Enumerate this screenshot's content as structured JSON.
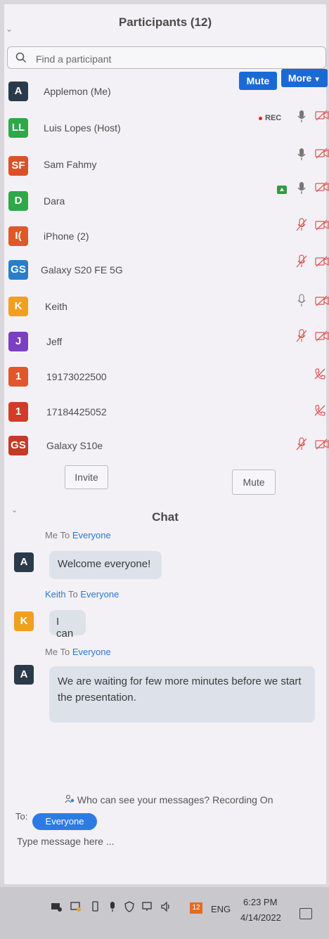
{
  "participants": {
    "title": "Participants (12)",
    "search_placeholder": "Find a participant",
    "mute_label": "Mute",
    "more_label": "More",
    "list": [
      {
        "initials": "A",
        "name": "Applemon (Me)",
        "color": "#2b3a4a"
      },
      {
        "initials": "LL",
        "name": "Luis Lopes (Host)",
        "color": "#2ea84a",
        "rec": "REC"
      },
      {
        "initials": "SF",
        "name": "Sam Fahmy",
        "color": "#d9522a"
      },
      {
        "initials": "D",
        "name": "Dara",
        "color": "#2ea84a"
      },
      {
        "initials": "I(",
        "name": "iPhone (2)",
        "color": "#e0572a"
      },
      {
        "initials": "GS",
        "name": "Galaxy S20 FE 5G",
        "color": "#2a7ec8"
      },
      {
        "initials": "K",
        "name": "Keith",
        "color": "#f0a020"
      },
      {
        "initials": "J",
        "name": "Jeff",
        "color": "#7b3fc4"
      },
      {
        "initials": "1",
        "name": "19173022500",
        "color": "#e0572a"
      },
      {
        "initials": "1",
        "name": "17184425052",
        "color": "#d03c28"
      },
      {
        "initials": "GS",
        "name": "Galaxy S10e",
        "color": "#c33a28"
      }
    ],
    "invite_label": "Invite",
    "mute_all_label": "Mute"
  },
  "chat": {
    "title": "Chat",
    "messages": [
      {
        "from": "Me",
        "to_word": "To",
        "to": "Everyone",
        "text": "Welcome everyone!"
      },
      {
        "from": "Keith",
        "to_word": "To",
        "to": "Everyone",
        "text": "I can"
      },
      {
        "from": "Me",
        "to_word": "To",
        "to": "Everyone",
        "text": "We are waiting for few more minutes before we start the presentation."
      }
    ],
    "who_can_see": "Who can see your messages? Recording On",
    "to_label": "To:",
    "recipient": "Everyone",
    "input_placeholder": "Type message here ..."
  },
  "taskbar": {
    "badge": "12",
    "language": "ENG",
    "time": "6:23 PM",
    "date": "4/14/2022"
  }
}
